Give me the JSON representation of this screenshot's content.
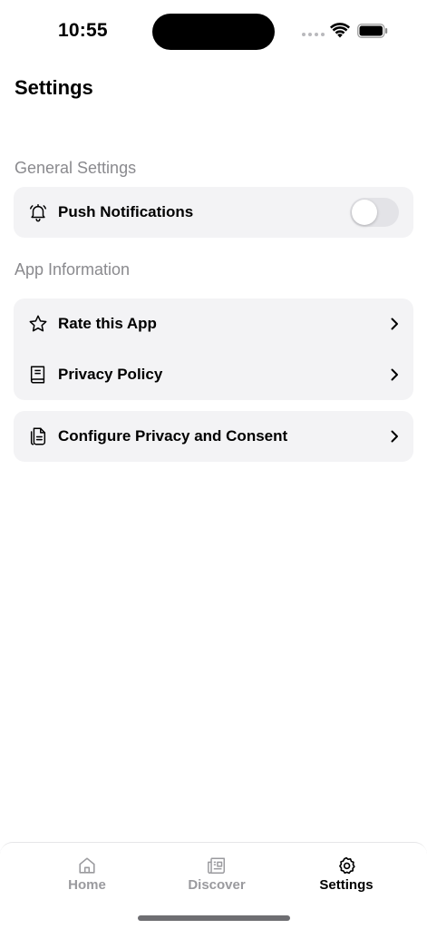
{
  "status_bar": {
    "time": "10:55"
  },
  "header": {
    "title": "Settings"
  },
  "sections": [
    {
      "title": "General Settings",
      "items": [
        {
          "label": "Push Notifications",
          "icon": "bell-icon",
          "control": "toggle",
          "toggle_on": false
        }
      ]
    },
    {
      "title": "App Information",
      "items": [
        {
          "label": "Rate this App",
          "icon": "star-icon",
          "control": "chevron"
        },
        {
          "label": "Privacy Policy",
          "icon": "book-icon",
          "control": "chevron"
        }
      ]
    }
  ],
  "consent": {
    "label": "Configure Privacy and Consent",
    "icon": "document-icon",
    "control": "chevron"
  },
  "tab_bar": {
    "tabs": [
      {
        "label": "Home",
        "icon": "home-icon",
        "active": false
      },
      {
        "label": "Discover",
        "icon": "newspaper-icon",
        "active": false
      },
      {
        "label": "Settings",
        "icon": "gear-icon",
        "active": true
      }
    ]
  },
  "colors": {
    "card_background": "#f3f3f5",
    "section_title": "#8a8a8e",
    "inactive_tab": "#9a9a9e",
    "toggle_off": "#e3e3e7"
  }
}
